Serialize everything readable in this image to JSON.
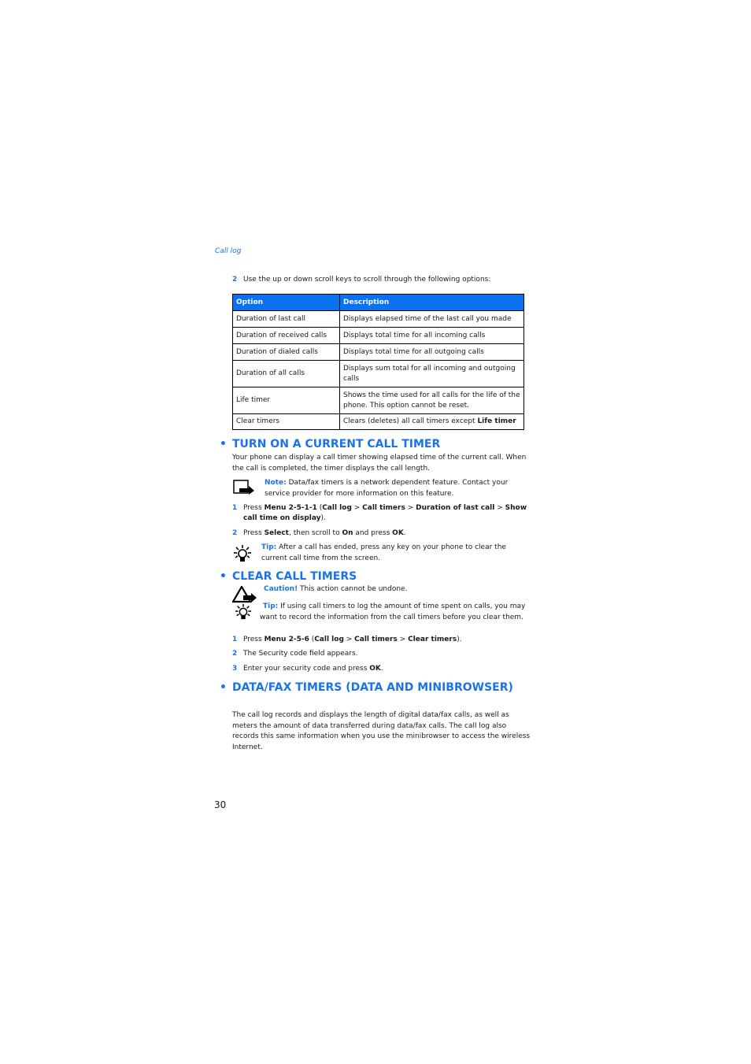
{
  "running_head": "Call log",
  "intro_step": {
    "num": "2",
    "text": "Use the up or down scroll keys to scroll through the following options:"
  },
  "table": {
    "headers": [
      "Option",
      "Description"
    ],
    "rows": [
      {
        "option": "Duration of last call",
        "description": "Displays elapsed time of the last call you made"
      },
      {
        "option": "Duration of received calls",
        "description": "Displays total time for all incoming calls"
      },
      {
        "option": "Duration of dialed calls",
        "description": "Displays total time for all outgoing calls"
      },
      {
        "option": "Duration of all calls",
        "description": "Displays sum total for all incoming and outgoing calls"
      },
      {
        "option": "Life timer",
        "description": "Shows the time used for all calls for the life of the phone. This option cannot be reset."
      },
      {
        "option": "Clear timers",
        "description_prefix": "Clears (deletes) all call timers except ",
        "description_bold": "Life timer"
      }
    ]
  },
  "section1": {
    "heading": "TURN ON A CURRENT CALL TIMER",
    "body": "Your phone can display a call timer showing elapsed time of the current call. When the call is completed, the timer displays the call length.",
    "note_label": "Note:",
    "note_text": " Data/fax timers is a network dependent feature. Contact your service provider for more information on this feature.",
    "step1": {
      "num": "1",
      "pre": "Press ",
      "b1": "Menu 2-5-1-1",
      "m1": " (",
      "b2": "Call log",
      "m2": " > ",
      "b3": "Call timers",
      "m3": " > ",
      "b4": "Duration of last call",
      "m4": " > ",
      "b5": "Show call time on display",
      "post": ")."
    },
    "step2": {
      "num": "2",
      "pre": "Press ",
      "b1": "Select",
      "m1": ", then scroll to ",
      "b2": "On",
      "m2": " and press ",
      "b3": "OK",
      "post": "."
    },
    "tip_label": "Tip:",
    "tip_text": " After a call has ended, press any key on your phone to clear the current call time from the screen."
  },
  "section2": {
    "heading": "CLEAR CALL TIMERS",
    "caution_label": "Caution!",
    "caution_text": " This action cannot be undone.",
    "tip_label": "Tip:",
    "tip_text": " If using call timers to log the amount of time spent on calls, you may want to record the information from the call timers before you clear them.",
    "step1": {
      "num": "1",
      "pre": "Press ",
      "b1": "Menu 2-5-6",
      "m1": " (",
      "b2": "Call log",
      "m2": " > ",
      "b3": "Call timers",
      "m3": " > ",
      "b4": "Clear timers",
      "post": ")."
    },
    "step2": {
      "num": "2",
      "text": "The Security code field appears."
    },
    "step3": {
      "num": "3",
      "pre": "Enter your security code and press ",
      "b1": "OK",
      "post": "."
    }
  },
  "section3": {
    "heading": "DATA/FAX TIMERS (DATA AND MINIBROWSER)",
    "body": "The call log records and displays the length of digital data/fax calls, as well as meters the amount of data transferred during data/fax calls. The call log also records this same information when you use the minibrowser to access the wireless Internet."
  },
  "page_number": "30",
  "colors": {
    "accent": "#1a74e8",
    "table_header": "#0a72f0"
  }
}
